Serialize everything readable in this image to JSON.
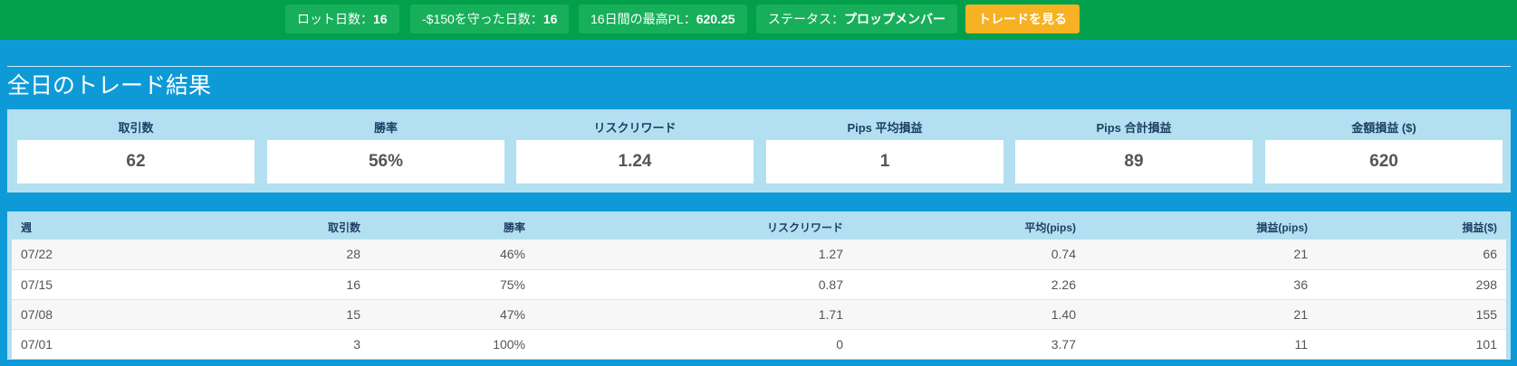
{
  "topbar": {
    "chips": [
      {
        "label": "ロット日数：",
        "value": "16"
      },
      {
        "label": "-$150を守った日数：",
        "value": "16"
      },
      {
        "label": "16日間の最高PL：",
        "value": "620.25"
      },
      {
        "label": "ステータス：",
        "value": "プロップメンバー"
      }
    ],
    "button_label": "トレードを見る",
    "colors": {
      "bar": "#02a04a",
      "chip": "#18af5a",
      "button": "#f6b222"
    }
  },
  "section": {
    "title": "全日のトレード結果"
  },
  "summary": [
    {
      "label": "取引数",
      "value": "62"
    },
    {
      "label": "勝率",
      "value": "56%"
    },
    {
      "label": "リスクリワード",
      "value": "1.24"
    },
    {
      "label": "Pips 平均損益",
      "value": "1"
    },
    {
      "label": "Pips 合計損益",
      "value": "89"
    },
    {
      "label": "金額損益 ($)",
      "value": "620"
    }
  ],
  "table": {
    "headers": [
      "週",
      "取引数",
      "勝率",
      "リスクリワード",
      "平均(pips)",
      "損益(pips)",
      "損益($)"
    ],
    "rows": [
      [
        "07/22",
        "28",
        "46%",
        "1.27",
        "0.74",
        "21",
        "66"
      ],
      [
        "07/15",
        "16",
        "75%",
        "0.87",
        "2.26",
        "36",
        "298"
      ],
      [
        "07/08",
        "15",
        "47%",
        "1.71",
        "1.40",
        "21",
        "155"
      ],
      [
        "07/01",
        "3",
        "100%",
        "0",
        "3.77",
        "11",
        "101"
      ]
    ]
  },
  "theme": {
    "background": "#0e9ad7",
    "panel": "#b3e0f1",
    "header_text": "#1e3f63"
  }
}
